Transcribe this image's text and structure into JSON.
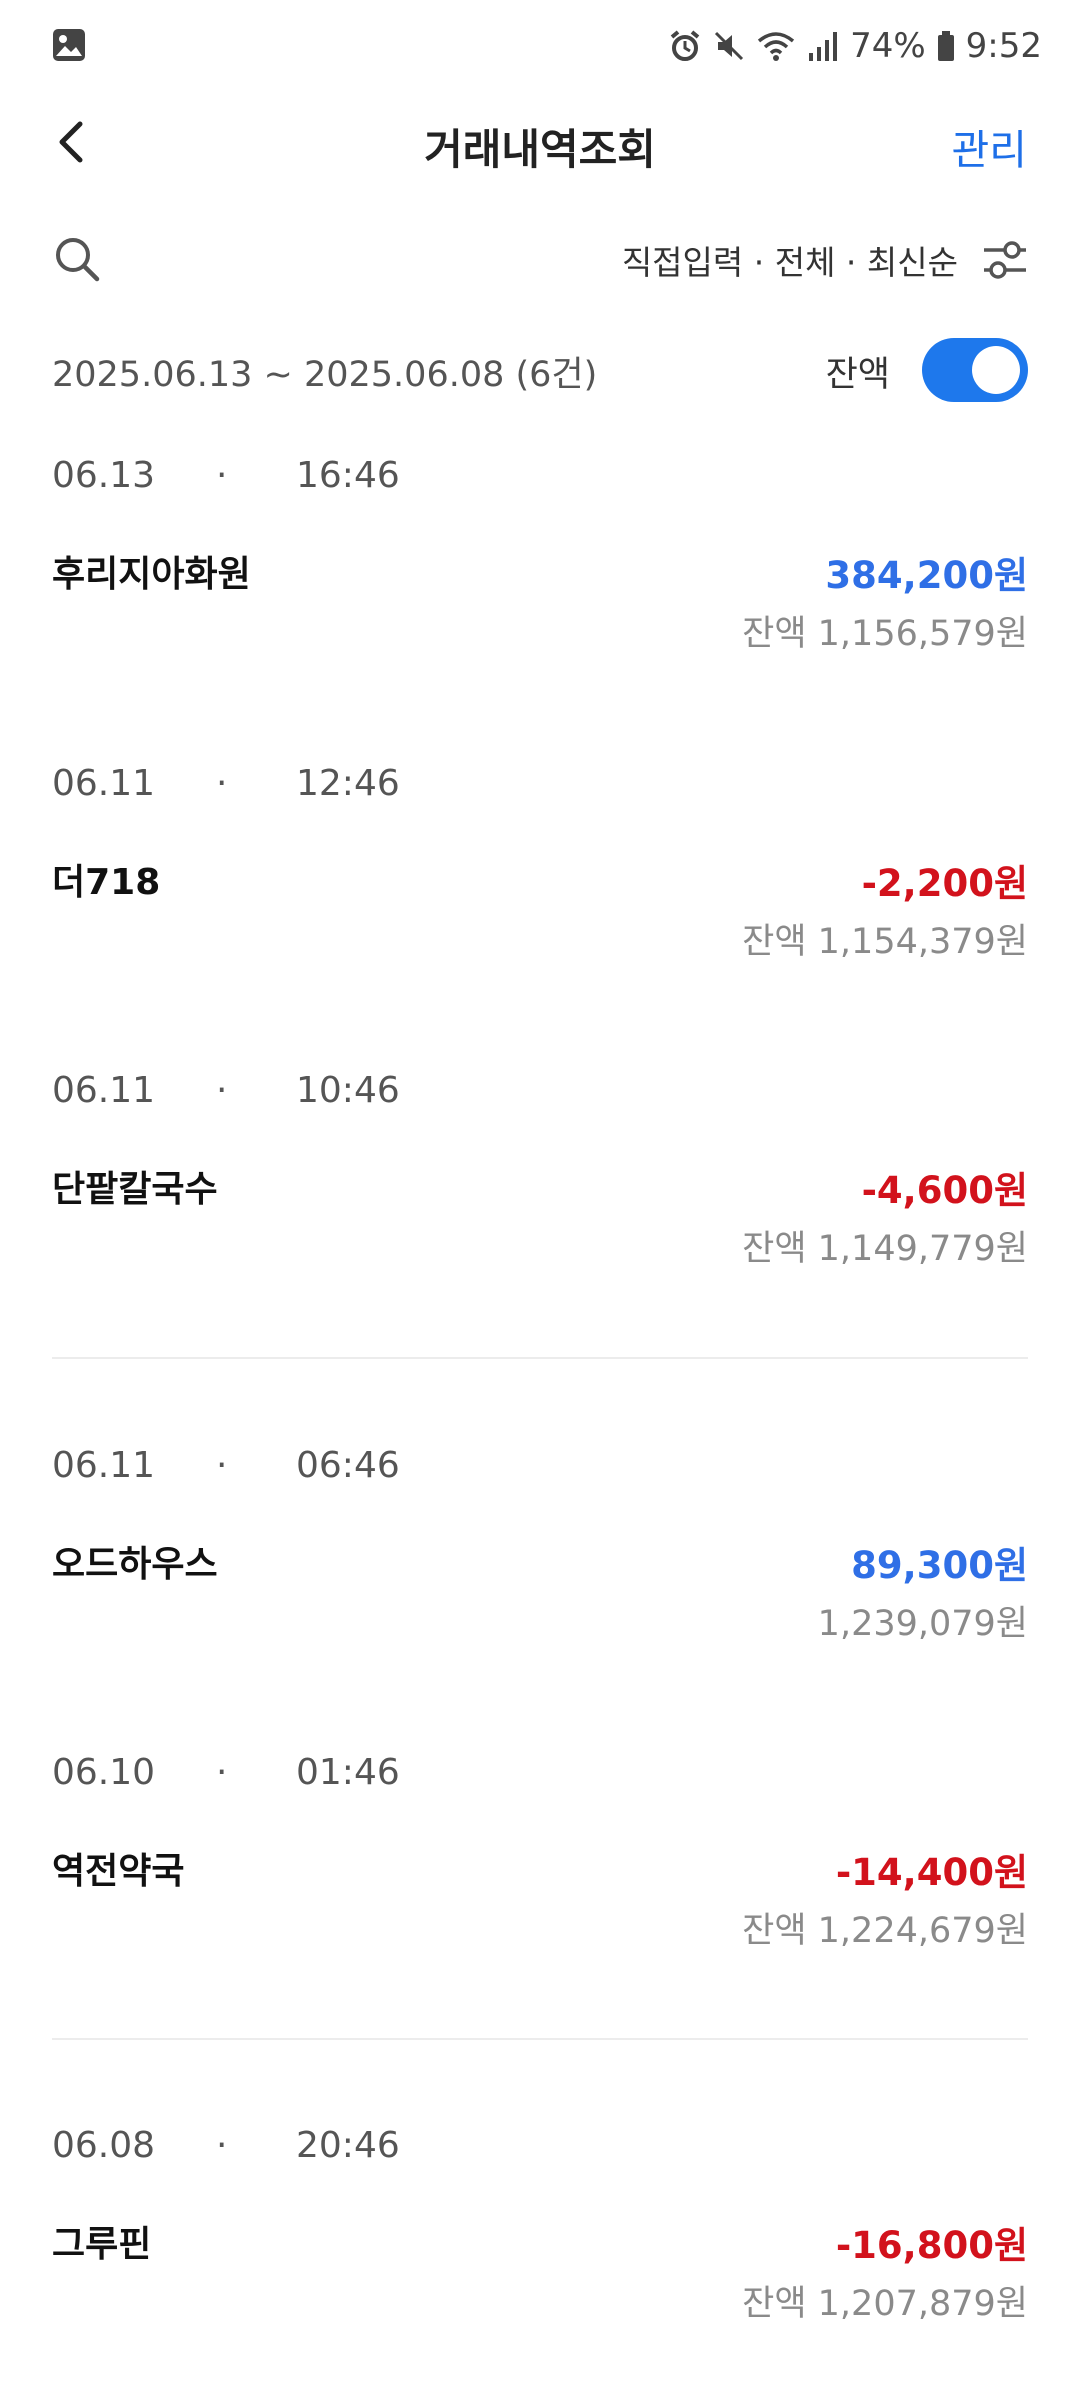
{
  "status_bar": {
    "battery": "74%",
    "time": "9:52",
    "icons": [
      "gallery-icon",
      "alarm-icon",
      "mute-icon",
      "wifi-icon",
      "signal-icon",
      "battery-icon"
    ]
  },
  "header": {
    "title": "거래내역조회",
    "manage_label": "관리",
    "back_icon": "chevron-left-icon"
  },
  "filter": {
    "text": "직접입력 · 전체 · 최신순",
    "search_icon": "search-icon",
    "settings_icon": "filter-sliders-icon"
  },
  "range": {
    "text": "2025.06.13 ~ 2025.06.08 (6건)",
    "balance_label": "잔액",
    "balance_toggle_on": true,
    "toggle_color": "#1e78ec"
  },
  "colors": {
    "accent": "#1e6fe8",
    "deposit": "#2f6fe6",
    "withdraw": "#d2121c",
    "muted": "#8a8a8a"
  },
  "transactions": [
    {
      "date": "06.13",
      "sep": "·",
      "time": "16:46",
      "merchant": "후리지아화원",
      "amount": "384,200원",
      "type": "deposit",
      "balance": "잔액 1,156,579원"
    },
    {
      "date": "06.11",
      "sep": "·",
      "time": "12:46",
      "merchant": "더718",
      "amount": "-2,200원",
      "type": "withdraw",
      "balance": "잔액 1,154,379원"
    },
    {
      "date": "06.11",
      "sep": "·",
      "time": "10:46",
      "merchant": "단팥칼국수",
      "amount": "-4,600원",
      "type": "withdraw",
      "balance": "잔액 1,149,779원"
    },
    {
      "date": "06.11",
      "sep": "·",
      "time": "06:46",
      "merchant": "오드하우스",
      "amount": "89,300원",
      "type": "deposit",
      "balance": "1,239,079원"
    },
    {
      "date": "06.10",
      "sep": "·",
      "time": "01:46",
      "merchant": "역전약국",
      "amount": "-14,400원",
      "type": "withdraw",
      "balance": "잔액 1,224,679원"
    },
    {
      "date": "06.08",
      "sep": "·",
      "time": "20:46",
      "merchant": "그루핀",
      "amount": "-16,800원",
      "type": "withdraw",
      "balance": "잔액 1,207,879원"
    }
  ]
}
